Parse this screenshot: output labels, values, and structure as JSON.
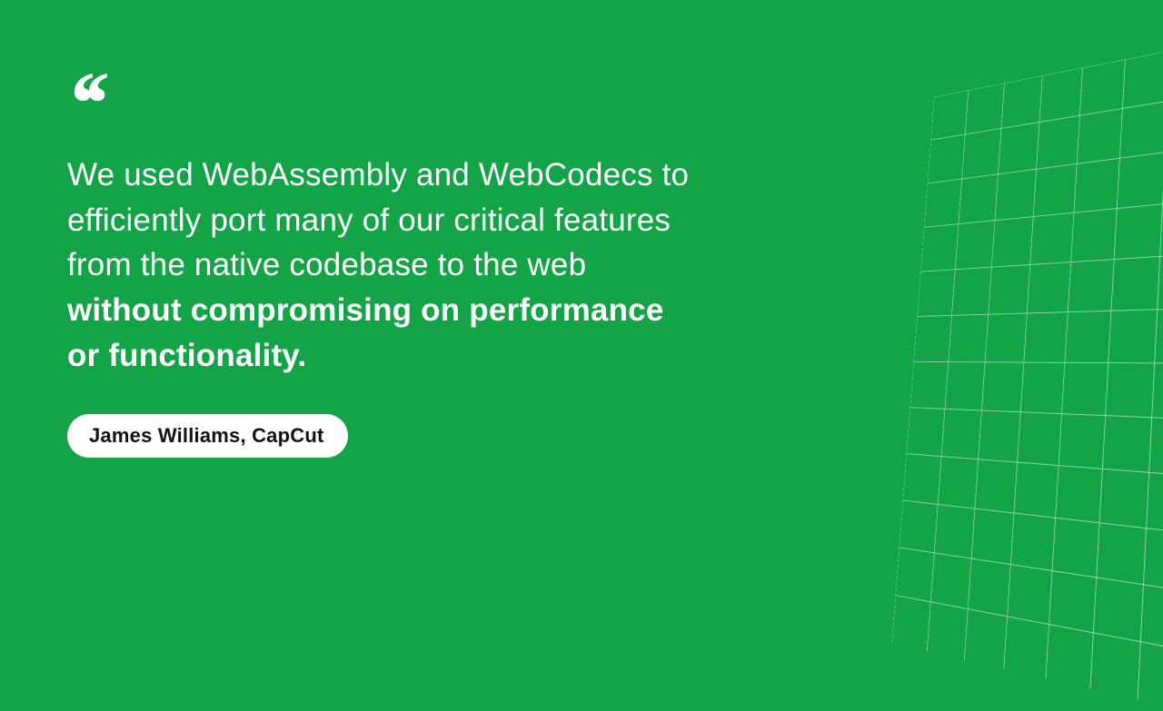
{
  "colors": {
    "bg": "#12a447",
    "text": "#ffffff",
    "pill_bg": "#ffffff",
    "pill_text": "#111111"
  },
  "quote": {
    "normal": "We used WebAssembly and WebCodecs to efficiently port many of our critical features from the native codebase to the web ",
    "emphasis": "without compromising on performance or functionality."
  },
  "attribution": "James Williams, CapCut"
}
